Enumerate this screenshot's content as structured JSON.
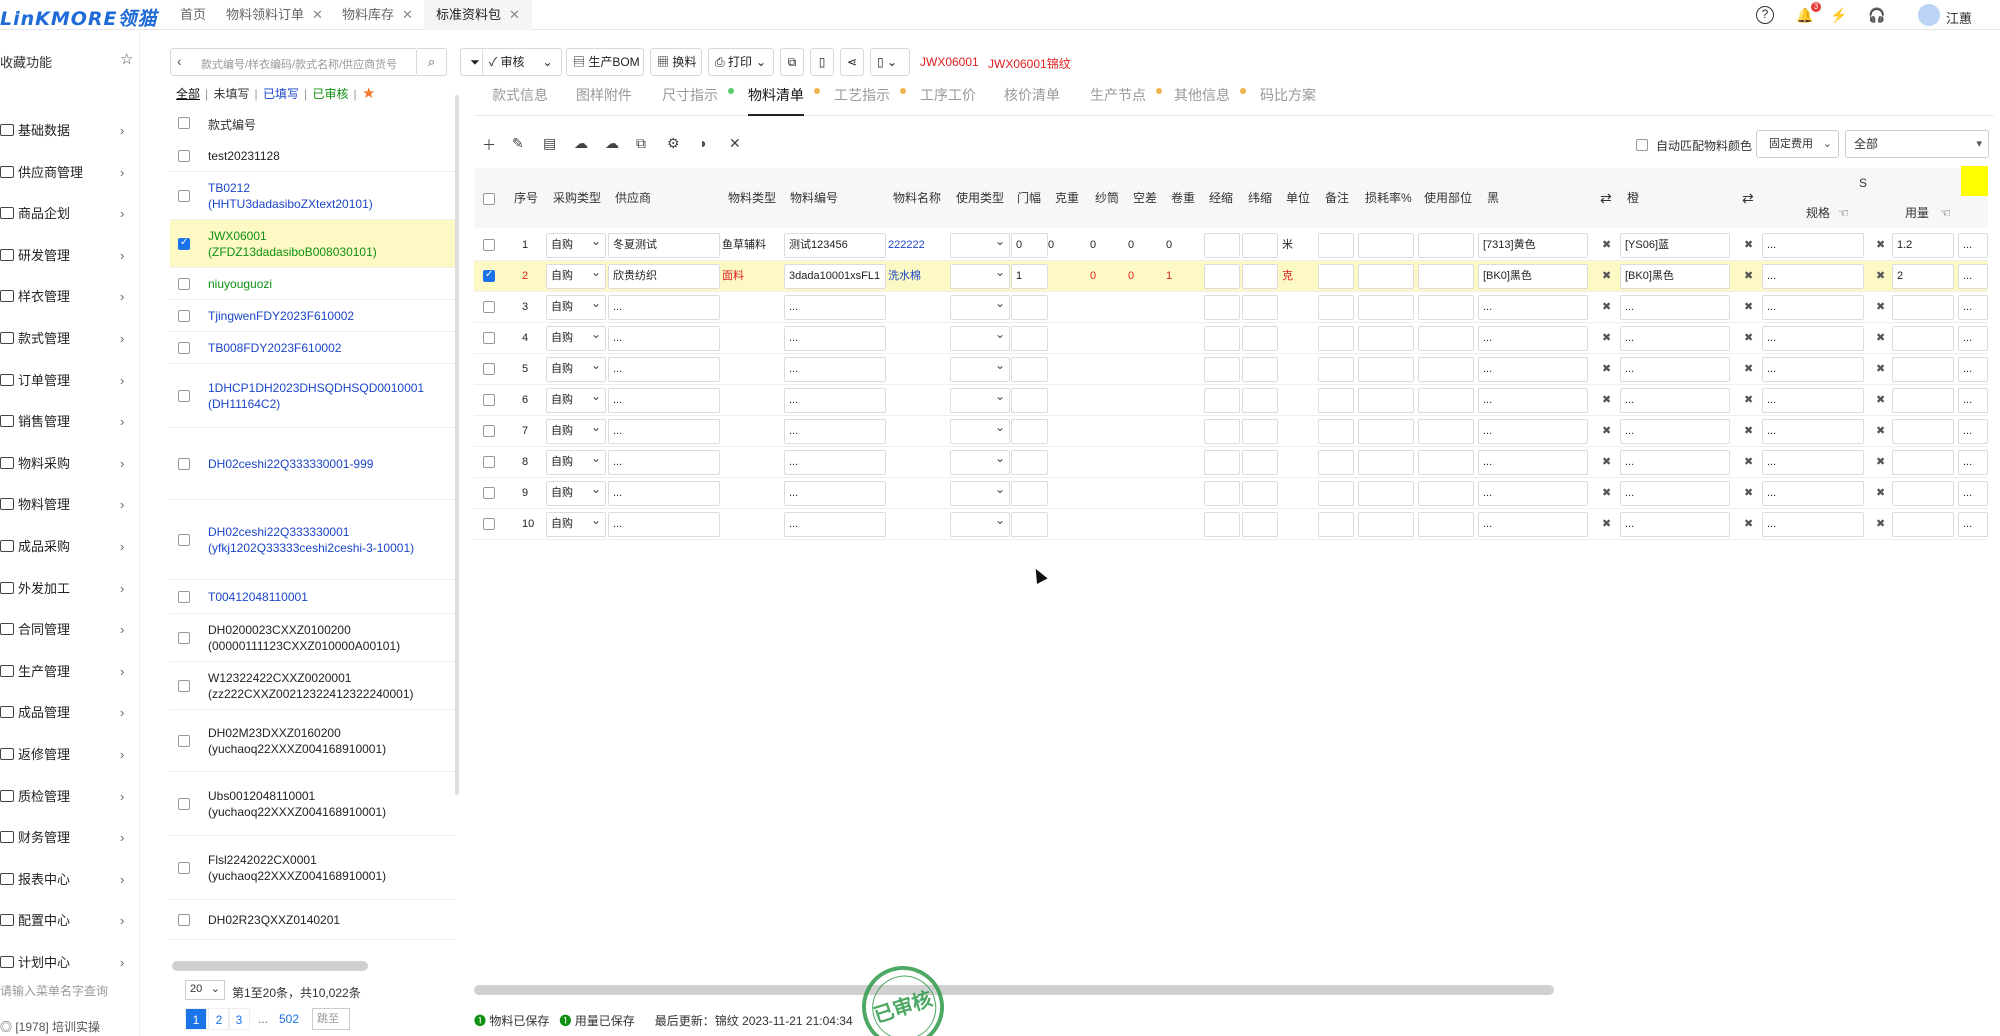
{
  "app": {
    "logo": "LinKMORE领猫",
    "tabs": [
      {
        "label": "首页",
        "closable": false
      },
      {
        "label": "物料领料订单",
        "closable": true
      },
      {
        "label": "物料库存",
        "closable": true
      },
      {
        "label": "标准资料包",
        "closable": true,
        "active": true
      }
    ],
    "bell_count": "3",
    "user_name": "江蕙",
    "icons": [
      "help-circle-icon",
      "bell-icon",
      "quick-action-icon",
      "headset-icon"
    ]
  },
  "sidebar": {
    "favorites_label": "收藏功能",
    "items": [
      {
        "label": "基础数据",
        "icon": "database-icon"
      },
      {
        "label": "供应商管理",
        "icon": "supplier-icon"
      },
      {
        "label": "商品企划",
        "icon": "plan-icon"
      },
      {
        "label": "研发管理",
        "icon": "rnd-icon"
      },
      {
        "label": "样衣管理",
        "icon": "sample-icon"
      },
      {
        "label": "款式管理",
        "icon": "style-icon"
      },
      {
        "label": "订单管理",
        "icon": "order-icon"
      },
      {
        "label": "销售管理",
        "icon": "sales-icon"
      },
      {
        "label": "物料采购",
        "icon": "purchase-icon"
      },
      {
        "label": "物料管理",
        "icon": "material-icon"
      },
      {
        "label": "成品采购",
        "icon": "product-purchase-icon"
      },
      {
        "label": "外发加工",
        "icon": "outsource-icon"
      },
      {
        "label": "合同管理",
        "icon": "contract-icon"
      },
      {
        "label": "生产管理",
        "icon": "production-icon"
      },
      {
        "label": "成品管理",
        "icon": "product-icon"
      },
      {
        "label": "返修管理",
        "icon": "repair-icon"
      },
      {
        "label": "质检管理",
        "icon": "qc-icon"
      },
      {
        "label": "财务管理",
        "icon": "finance-icon"
      },
      {
        "label": "报表中心",
        "icon": "report-icon"
      },
      {
        "label": "配置中心",
        "icon": "config-icon"
      },
      {
        "label": "计划中心",
        "icon": "schedule-icon"
      }
    ],
    "search_placeholder": "请输入菜单名字查询",
    "training": "[1978] 培训实操"
  },
  "list": {
    "search_placeholder": "款式编号/样衣编码/款式名称/供应商货号",
    "filters": {
      "all": "全部",
      "unfilled": "未填写",
      "filled": "已填写",
      "approved": "已审核"
    },
    "column_header": "款式编号",
    "rows": [
      {
        "line1": "test20231128",
        "line2": "",
        "color": "black"
      },
      {
        "line1": "TB0212",
        "line2": "(HHTU3dadasiboZXtext20101)",
        "color": "blue"
      },
      {
        "line1": "JWX06001",
        "line2": "(ZFDZ13dadasiboB008030101)",
        "color": "green",
        "selected": true
      },
      {
        "line1": "niuyouguozi",
        "line2": "",
        "color": "green"
      },
      {
        "line1": "TjingwenFDY2023F610002",
        "line2": "",
        "color": "blue"
      },
      {
        "line1": "TB008FDY2023F610002",
        "line2": "",
        "color": "blue"
      },
      {
        "line1": "1DHCP1DH2023DHSQDHSQD0010001",
        "line2": "(DH11164C2)",
        "color": "blue"
      },
      {
        "line1": "DH02ceshi22Q333330001-999",
        "line2": "",
        "color": "blue"
      },
      {
        "line1": "DH02ceshi22Q333330001",
        "line2": "(yfkj1202Q33333ceshi2ceshi-3-10001)",
        "color": "blue"
      },
      {
        "line1": "T00412048110001",
        "line2": "",
        "color": "blue"
      },
      {
        "line1": "DH0200023CXXZ0100200",
        "line2": "(00000111123CXXZ010000A00101)",
        "color": "black"
      },
      {
        "line1": "W12322422CXXZ0020001",
        "line2": "(zz222CXXZ00212322412322240001)",
        "color": "black"
      },
      {
        "line1": "DH02M23DXXZ0160200",
        "line2": "(yuchaoq22XXXZ004168910001)",
        "color": "black"
      },
      {
        "line1": "Ubs0012048110001",
        "line2": "(yuchaoq22XXXZ004168910001)",
        "color": "black"
      },
      {
        "line1": "Flsl2242022CX0001",
        "line2": "(yuchaoq22XXXZ004168910001)",
        "color": "black"
      },
      {
        "line1": "DH02R23QXXZ0140201",
        "line2": "",
        "color": "black"
      }
    ],
    "page_size": "20",
    "summary": "第1至20条，共10,022条",
    "pages": [
      "1",
      "2",
      "3",
      "...",
      "502"
    ],
    "jump": "跳至"
  },
  "toolbar": {
    "review": "审核",
    "bom": "生产BOM",
    "change": "换料",
    "print": "打印",
    "style_code": "JWX06001",
    "style_name": "JWX06001锦纹"
  },
  "subtabs": [
    {
      "label": "款式信息",
      "dot": ""
    },
    {
      "label": "图样附件",
      "dot": ""
    },
    {
      "label": "尺寸指示",
      "dot": "#5cc96b"
    },
    {
      "label": "物料清单",
      "dot": "#f0b24a",
      "active": true
    },
    {
      "label": "工艺指示",
      "dot": "#f0b24a"
    },
    {
      "label": "工序工价",
      "dot": ""
    },
    {
      "label": "核价清单",
      "dot": ""
    },
    {
      "label": "生产节点",
      "dot": "#f0b24a"
    },
    {
      "label": "其他信息",
      "dot": "#f0b24a"
    },
    {
      "label": "码比方案",
      "dot": ""
    }
  ],
  "controls": {
    "auto_match": "自动匹配物料颜色",
    "fixed_cost": "固定费用",
    "all": "全部"
  },
  "grid": {
    "headers": {
      "seq": "序号",
      "purchase_type": "采购类型",
      "supplier": "供应商",
      "material_type": "物料类型",
      "material_code": "物料编号",
      "material_name": "物料名称",
      "usage_type": "使用类型",
      "width": "门幅",
      "weight": "克重",
      "yarn": "纱筒",
      "empty": "空差",
      "roll": "卷重",
      "warp": "经缩",
      "weft": "纬缩",
      "unit": "单位",
      "remark": "备注",
      "loss": "损耗率%",
      "part": "使用部位",
      "color1": "黑",
      "color2": "橙",
      "size_group": "S",
      "spec": "规格",
      "qty": "用量"
    },
    "rows": [
      {
        "seq": "1",
        "ptype": "自购",
        "supplier": "冬夏测试",
        "mtype": "鱼草辅料",
        "code": "测试123456",
        "name": "222222",
        "width": "0",
        "weight": "0",
        "yarn": "0",
        "empty": "0",
        "roll": "0",
        "unit": "米",
        "c1": "[7313]黄色",
        "c2": "[YS06]蓝",
        "spec": "...",
        "qty": "1.2",
        "hl": false
      },
      {
        "seq": "2",
        "ptype": "自购",
        "supplier": "欣贵纺织",
        "mtype": "面料",
        "code": "3dada10001xsFL1",
        "name": "洗水棉",
        "width": "1",
        "weight": "",
        "yarn": "0",
        "empty": "0",
        "roll": "1",
        "unit": "克",
        "c1": "[BK0]黑色",
        "c2": "[BK0]黑色",
        "spec": "...",
        "qty": "2",
        "hl": true
      },
      {
        "seq": "3",
        "ptype": "自购",
        "supplier": "...",
        "mtype": "",
        "code": "...",
        "name": "",
        "width": "",
        "weight": "",
        "yarn": "",
        "empty": "",
        "roll": "",
        "unit": "",
        "c1": "...",
        "c2": "...",
        "spec": "...",
        "qty": "",
        "hl": false
      },
      {
        "seq": "4",
        "ptype": "自购",
        "supplier": "...",
        "mtype": "",
        "code": "...",
        "name": "",
        "width": "",
        "weight": "",
        "yarn": "",
        "empty": "",
        "roll": "",
        "unit": "",
        "c1": "...",
        "c2": "...",
        "spec": "...",
        "qty": "",
        "hl": false
      },
      {
        "seq": "5",
        "ptype": "自购",
        "supplier": "...",
        "mtype": "",
        "code": "...",
        "name": "",
        "width": "",
        "weight": "",
        "yarn": "",
        "empty": "",
        "roll": "",
        "unit": "",
        "c1": "...",
        "c2": "...",
        "spec": "...",
        "qty": "",
        "hl": false
      },
      {
        "seq": "6",
        "ptype": "自购",
        "supplier": "...",
        "mtype": "",
        "code": "...",
        "name": "",
        "width": "",
        "weight": "",
        "yarn": "",
        "empty": "",
        "roll": "",
        "unit": "",
        "c1": "...",
        "c2": "...",
        "spec": "...",
        "qty": "",
        "hl": false
      },
      {
        "seq": "7",
        "ptype": "自购",
        "supplier": "...",
        "mtype": "",
        "code": "...",
        "name": "",
        "width": "",
        "weight": "",
        "yarn": "",
        "empty": "",
        "roll": "",
        "unit": "",
        "c1": "...",
        "c2": "...",
        "spec": "...",
        "qty": "",
        "hl": false
      },
      {
        "seq": "8",
        "ptype": "自购",
        "supplier": "...",
        "mtype": "",
        "code": "...",
        "name": "",
        "width": "",
        "weight": "",
        "yarn": "",
        "empty": "",
        "roll": "",
        "unit": "",
        "c1": "...",
        "c2": "...",
        "spec": "...",
        "qty": "",
        "hl": false
      },
      {
        "seq": "9",
        "ptype": "自购",
        "supplier": "...",
        "mtype": "",
        "code": "...",
        "name": "",
        "width": "",
        "weight": "",
        "yarn": "",
        "empty": "",
        "roll": "",
        "unit": "",
        "c1": "...",
        "c2": "...",
        "spec": "...",
        "qty": "",
        "hl": false
      },
      {
        "seq": "10",
        "ptype": "自购",
        "supplier": "...",
        "mtype": "",
        "code": "...",
        "name": "",
        "width": "",
        "weight": "",
        "yarn": "",
        "empty": "",
        "roll": "",
        "unit": "",
        "c1": "...",
        "c2": "...",
        "spec": "...",
        "qty": "",
        "hl": false
      }
    ]
  },
  "status": {
    "material_saved": "物料已保存",
    "qty_saved": "用量已保存",
    "last_update": "最后更新：锦纹 2023-11-21 21:04:34",
    "stamp": "已审核"
  }
}
